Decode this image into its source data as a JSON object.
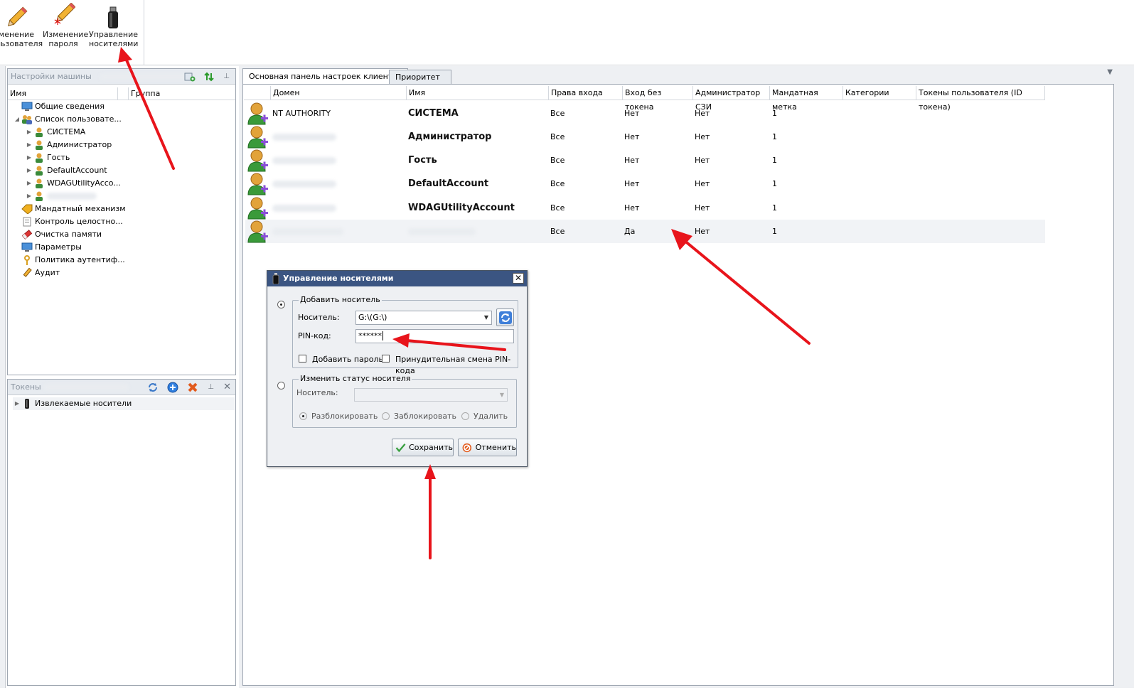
{
  "ribbon": {
    "buttons": [
      {
        "label1": "менение",
        "label2": "льзователя"
      },
      {
        "label1": "Изменение",
        "label2": "пароля"
      },
      {
        "label1": "Управление",
        "label2": "носителями"
      }
    ]
  },
  "machine_panel": {
    "title": "Настройки машины",
    "columns": [
      "Имя",
      "Группа"
    ],
    "tree": [
      {
        "label": "Общие сведения",
        "icon": "monitor-icon"
      },
      {
        "label": "Список пользовате...",
        "icon": "users-icon"
      },
      {
        "label": "СИСТЕМА",
        "icon": "user-icon"
      },
      {
        "label": "Администратор",
        "icon": "user-icon"
      },
      {
        "label": "Гость",
        "icon": "user-icon"
      },
      {
        "label": "DefaultAccount",
        "icon": "user-icon"
      },
      {
        "label": "WDAGUtilityAcco...",
        "icon": "user-icon"
      },
      {
        "label": "",
        "icon": "user-icon"
      },
      {
        "label": "Мандатный механизм",
        "icon": "tag-icon"
      },
      {
        "label": "Контроль целостно...",
        "icon": "document-icon"
      },
      {
        "label": "Очистка памяти",
        "icon": "eraser-icon"
      },
      {
        "label": "Параметры",
        "icon": "monitor-icon"
      },
      {
        "label": "Политика аутентиф...",
        "icon": "key-icon"
      },
      {
        "label": "Аудит",
        "icon": "pencil-icon"
      }
    ]
  },
  "token_panel": {
    "title": "Токены",
    "items": [
      {
        "label": "Извлекаемые носители"
      }
    ]
  },
  "main": {
    "tabs": [
      {
        "label": "Основная панель настроек клиентов"
      },
      {
        "label": "Приоритет"
      }
    ],
    "columns": [
      "Домен",
      "Имя",
      "Права входа",
      "Вход без токена",
      "Администратор СЗИ",
      "Мандатная метка",
      "Категории",
      "Токены пользователя (ID токена)"
    ],
    "users": [
      {
        "domain": "NT AUTHORITY",
        "name": "СИСТЕМА",
        "rights": "Все",
        "no_token": "Нет",
        "admin": "Нет",
        "label": "1"
      },
      {
        "domain": "",
        "name": "Администратор",
        "rights": "Все",
        "no_token": "Нет",
        "admin": "Нет",
        "label": "1"
      },
      {
        "domain": "",
        "name": "Гость",
        "rights": "Все",
        "no_token": "Нет",
        "admin": "Нет",
        "label": "1"
      },
      {
        "domain": "",
        "name": "DefaultAccount",
        "rights": "Все",
        "no_token": "Нет",
        "admin": "Нет",
        "label": "1"
      },
      {
        "domain": "",
        "name": "WDAGUtilityAccount",
        "rights": "Все",
        "no_token": "Нет",
        "admin": "Нет",
        "label": "1"
      },
      {
        "domain": "",
        "name": "",
        "rights": "Все",
        "no_token": "Да",
        "admin": "Нет",
        "label": "1"
      }
    ]
  },
  "dialog": {
    "title": "Управление носителями",
    "add_group": "Добавить носитель",
    "carrier_label": "Носитель:",
    "carrier_value": "G:\\(G:\\)",
    "pin_label": "PIN-код:",
    "pin_value": "******",
    "add_password": "Добавить пароль",
    "force_pin_change": "Принудительная смена PIN-кода",
    "status_group": "Изменить статус носителя",
    "status_carrier_label": "Носитель:",
    "unlock": "Разблокировать",
    "lock": "Заблокировать",
    "delete": "Удалить",
    "save": "Сохранить",
    "cancel": "Отменить"
  },
  "colors": {
    "accent_red": "#e8141b",
    "dialog_title": "#3b5582"
  }
}
